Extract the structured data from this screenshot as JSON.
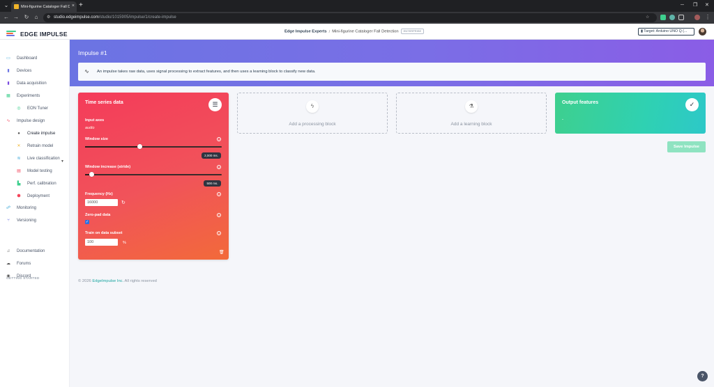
{
  "browser": {
    "tab_title": "Mini-figurine Cataloger Fall Det...",
    "url_host": "studio.edgeimpulse.com",
    "url_path": "/studio/1015905/impulse/1/create-impulse"
  },
  "brand": {
    "logo_text": "EDGE IMPULSE",
    "logo_colors": [
      "#3ecf8e",
      "#f26a3a",
      "#6b74e3"
    ]
  },
  "header": {
    "org": "Edge Impulse Experts",
    "project": "Mini-figurine Cataloger Fall Detection",
    "badge": "ENTERPRISE",
    "target": "Target: Arduino UNO Q (..."
  },
  "sidebar": {
    "items": [
      {
        "label": "Dashboard",
        "icon": "monitor-icon",
        "color": "#3aa6d8"
      },
      {
        "label": "Devices",
        "icon": "device-icon",
        "color": "#6b74e3"
      },
      {
        "label": "Data acquisition",
        "icon": "database-icon",
        "color": "#7a4be0"
      },
      {
        "label": "Experiments",
        "icon": "grid-icon",
        "color": "#3ecf8e"
      },
      {
        "label": "EON Tuner",
        "icon": "tuner-icon",
        "color": "#3ecf8e"
      },
      {
        "label": "Impulse design",
        "icon": "wave-icon",
        "color": "#f4445a"
      },
      {
        "label": "Create impulse",
        "icon": "dot-icon",
        "color": "#555555"
      },
      {
        "label": "Retrain model",
        "icon": "retrain-icon",
        "color": "#f0b429"
      },
      {
        "label": "Live classification",
        "icon": "live-icon",
        "color": "#3aa6d8"
      },
      {
        "label": "Model testing",
        "icon": "testing-icon",
        "color": "#f4445a"
      },
      {
        "label": "Perf. calibration",
        "icon": "calibration-icon",
        "color": "#3ecf8e"
      },
      {
        "label": "Deployment",
        "icon": "deployment-icon",
        "color": "#f4445a"
      },
      {
        "label": "Monitoring",
        "icon": "monitoring-icon",
        "color": "#3aa6d8"
      },
      {
        "label": "Versioning",
        "icon": "versioning-icon",
        "color": "#6b74e3"
      },
      {
        "label": "Documentation",
        "icon": "book-icon",
        "color": "#555555"
      },
      {
        "label": "Forums",
        "icon": "forum-icon",
        "color": "#555555"
      },
      {
        "label": "Discord",
        "icon": "discord-icon",
        "color": "#555555"
      }
    ],
    "section_label": "GETTING STARTED"
  },
  "page": {
    "title": "Impulse #1",
    "info": "An impulse takes raw data, uses signal processing to extract features, and then uses a learning block to classify new data."
  },
  "time_series": {
    "title": "Time series data",
    "input_axes_label": "Input axes",
    "input_axes_value": "audio",
    "window_size_label": "Window size",
    "window_size_value": "2,000 ms.",
    "window_size_fraction": 0.4,
    "window_increase_label": "Window increase (stride)",
    "window_increase_value": "500 ms.",
    "window_increase_fraction": 0.05,
    "frequency_label": "Frequency (Hz)",
    "frequency_value": "16000",
    "zero_pad_label": "Zero-pad data",
    "zero_pad_checked": true,
    "subset_label": "Train on data subset",
    "subset_value": "100",
    "subset_unit": "%"
  },
  "blocks": {
    "processing_label": "Add a processing block",
    "learning_label": "Add a learning block"
  },
  "output": {
    "title": "Output features",
    "value": "-"
  },
  "actions": {
    "save": "Save Impulse"
  },
  "footer": {
    "prefix": "© 2026",
    "company": "EdgeImpulse Inc.",
    "suffix": "All rights reserved"
  }
}
